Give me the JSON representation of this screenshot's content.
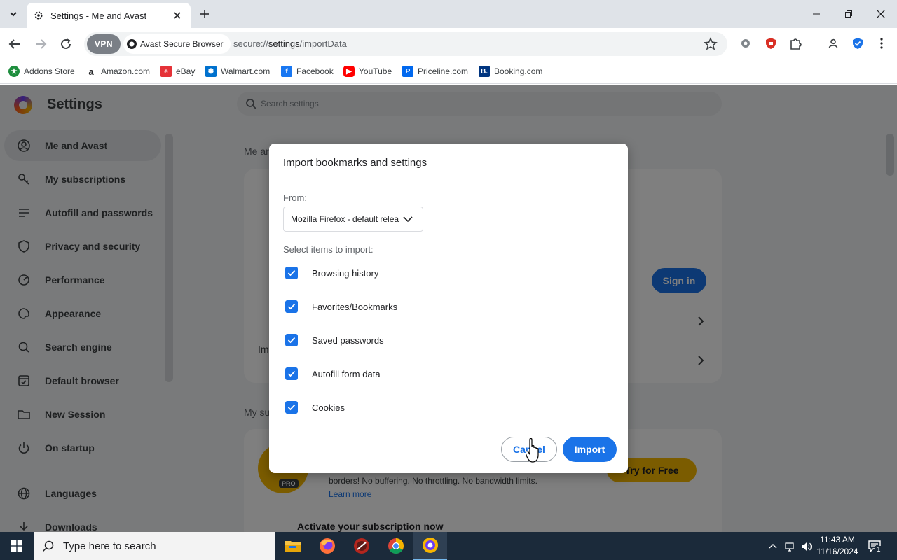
{
  "browser": {
    "tab_title": "Settings - Me and Avast",
    "vpn_label": "VPN",
    "site_chip": "Avast Secure Browser",
    "url_scheme": "secure://",
    "url_host": "settings",
    "url_path": "/importData"
  },
  "bookmarks": [
    {
      "label": "Addons Store",
      "icon": "addons-store-icon"
    },
    {
      "label": "Amazon.com",
      "icon": "amazon-icon"
    },
    {
      "label": "eBay",
      "icon": "ebay-icon"
    },
    {
      "label": "Walmart.com",
      "icon": "walmart-icon"
    },
    {
      "label": "Facebook",
      "icon": "facebook-icon"
    },
    {
      "label": "YouTube",
      "icon": "youtube-icon"
    },
    {
      "label": "Priceline.com",
      "icon": "priceline-icon"
    },
    {
      "label": "Booking.com",
      "icon": "booking-icon"
    }
  ],
  "settings": {
    "title": "Settings",
    "search_placeholder": "Search settings",
    "nav": [
      {
        "label": "Me and Avast",
        "icon": "person-circle-icon",
        "active": true
      },
      {
        "label": "My subscriptions",
        "icon": "key-icon"
      },
      {
        "label": "Autofill and passwords",
        "icon": "list-icon"
      },
      {
        "label": "Privacy and security",
        "icon": "shield-icon"
      },
      {
        "label": "Performance",
        "icon": "speedometer-icon"
      },
      {
        "label": "Appearance",
        "icon": "palette-icon"
      },
      {
        "label": "Search engine",
        "icon": "search-icon"
      },
      {
        "label": "Default browser",
        "icon": "browser-icon"
      },
      {
        "label": "New Session",
        "icon": "folder-icon"
      },
      {
        "label": "On startup",
        "icon": "power-icon"
      },
      {
        "label": "Languages",
        "icon": "globe-icon"
      },
      {
        "label": "Downloads",
        "icon": "download-icon"
      }
    ],
    "sign_in": "Sign in",
    "section_me": "Me ar",
    "section_subs": "My su",
    "row_import_partial": "Im",
    "pro_badge": "PRO",
    "promo_text": "borders! No buffering. No throttling. No bandwidth limits.",
    "learn_more": "Learn more",
    "try_free": "Try for Free",
    "activate": "Activate your subscription now"
  },
  "dialog": {
    "title": "Import bookmarks and settings",
    "from_label": "From:",
    "from_value": "Mozilla Firefox - default release",
    "items_label": "Select items to import:",
    "items": [
      {
        "label": "Browsing history",
        "checked": true
      },
      {
        "label": "Favorites/Bookmarks",
        "checked": true
      },
      {
        "label": "Saved passwords",
        "checked": true
      },
      {
        "label": "Autofill form data",
        "checked": true
      },
      {
        "label": "Cookies",
        "checked": true
      }
    ],
    "cancel": "Cancel",
    "import": "Import"
  },
  "taskbar": {
    "search_placeholder": "Type here to search",
    "time": "11:43 AM",
    "date": "11/16/2024",
    "notification_count": "1"
  },
  "colors": {
    "accent": "#1a73e8",
    "taskbar": "#1b2a3a"
  }
}
